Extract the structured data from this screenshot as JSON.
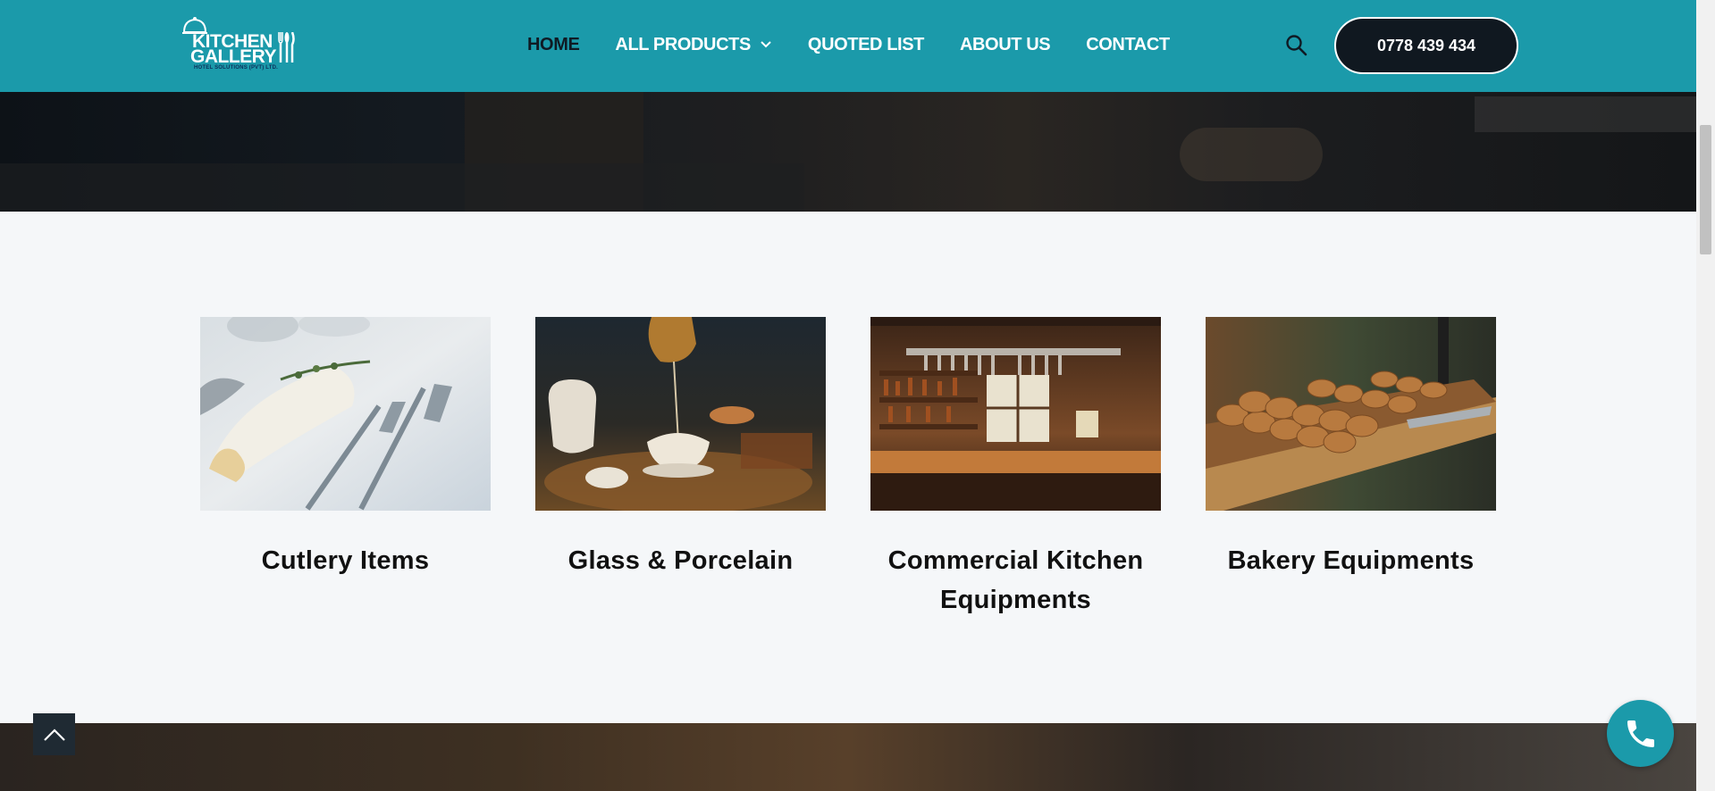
{
  "brand": {
    "logo_line1": "KITCHEN",
    "logo_line2": "GALLERY",
    "logo_tagline": "HOTEL SOLUTIONS (PVT) LTD."
  },
  "nav": {
    "items": [
      {
        "label": "HOME",
        "active": true
      },
      {
        "label": "ALL PRODUCTS",
        "has_dropdown": true
      },
      {
        "label": "QUOTED LIST"
      },
      {
        "label": "ABOUT US"
      },
      {
        "label": "CONTACT"
      }
    ]
  },
  "header": {
    "search_icon": "search-icon",
    "phone_label": "0778 439 434"
  },
  "categories": [
    {
      "title": "Cutlery Items",
      "image": "cutlery-photo"
    },
    {
      "title": "Glass & Porcelain",
      "image": "tea-set-photo"
    },
    {
      "title": "Commercial Kitchen Equipments",
      "image": "bar-kitchen-photo"
    },
    {
      "title": "Bakery Equipments",
      "image": "cookies-tray-photo"
    }
  ],
  "colors": {
    "header_bg": "#1b9aaa",
    "phone_button_bg": "#101820",
    "active_nav": "#0f1a24",
    "section_bg": "#f5f7f9"
  },
  "floating": {
    "back_to_top_icon": "chevron-up-icon",
    "call_icon": "phone-icon"
  }
}
